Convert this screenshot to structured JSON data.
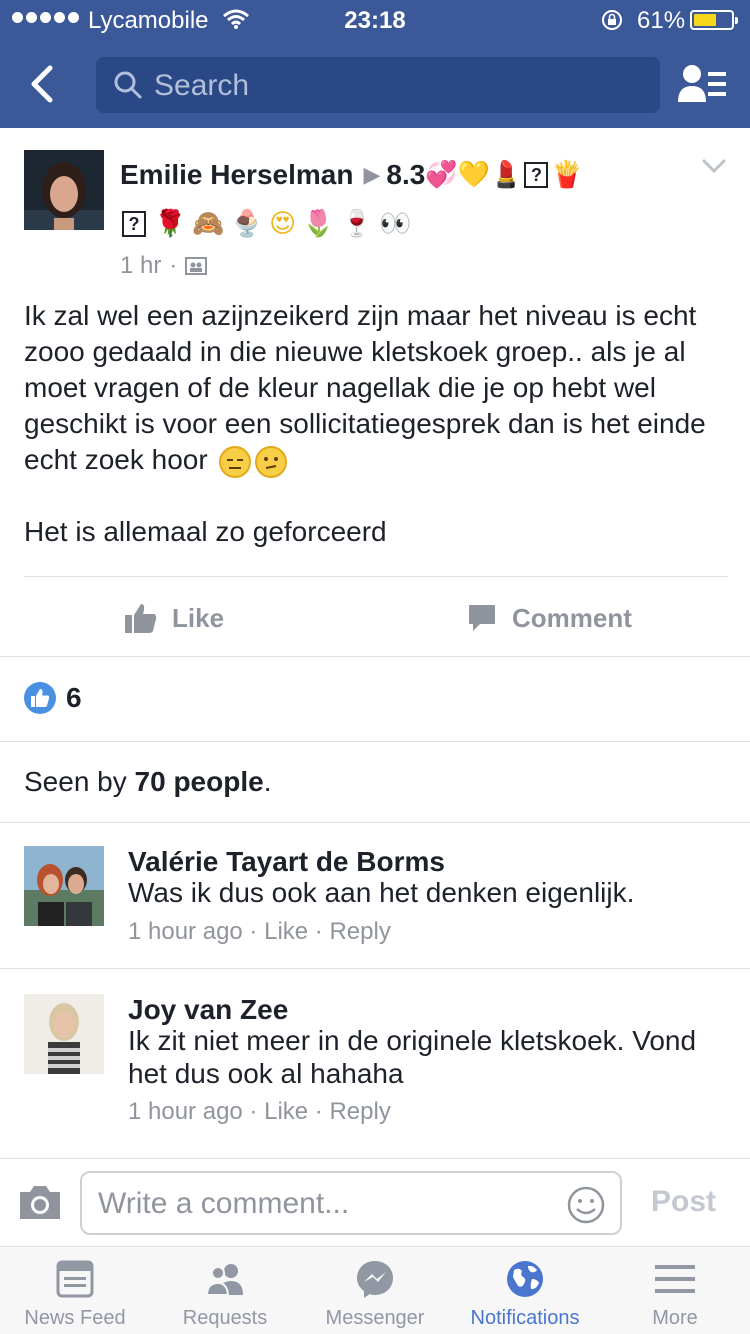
{
  "status_bar": {
    "carrier": "Lycamobile",
    "time": "23:18",
    "battery_percent": "61%",
    "battery_level": 0.61
  },
  "nav": {
    "search_placeholder": "Search"
  },
  "post": {
    "author": "Emilie Herselman",
    "group": "8.3",
    "time": "1 hr",
    "paragraphs": [
      "Ik zal wel een azijnzeikerd zijn maar het niveau is echt zooo gedaald in die nieuwe kletskoek groep.. als je al moet vragen of de kleur nagellak die je op hebt wel geschikt is voor een sollicitatiegesprek dan is het einde echt zoek hoor",
      "Het is allemaal zo geforceerd"
    ],
    "like_label": "Like",
    "comment_label": "Comment",
    "like_count": "6",
    "seen_prefix": "Seen by ",
    "seen_count": "70 people",
    "seen_suffix": "."
  },
  "comments": [
    {
      "name": "Valérie Tayart de Borms",
      "text": "Was ik dus ook aan het denken eigenlijk.",
      "time": "1 hour ago",
      "like": "Like",
      "reply": "Reply"
    },
    {
      "name": "Joy van Zee",
      "text": "Ik zit niet meer in de originele kletskoek. Vond het dus ook al hahaha",
      "time": "1 hour ago",
      "like": "Like",
      "reply": "Reply"
    }
  ],
  "composer": {
    "placeholder": "Write a comment...",
    "post_label": "Post"
  },
  "tabs": [
    {
      "label": "News Feed",
      "icon": "news-feed-icon"
    },
    {
      "label": "Requests",
      "icon": "requests-icon"
    },
    {
      "label": "Messenger",
      "icon": "messenger-icon"
    },
    {
      "label": "Notifications",
      "icon": "notifications-globe-icon",
      "active": true
    },
    {
      "label": "More",
      "icon": "more-menu-icon"
    }
  ],
  "colors": {
    "header_blue": "#3b5998",
    "search_bg": "#2a4886",
    "active_tab": "#4a76d0",
    "like_blue": "#4a90e2"
  }
}
